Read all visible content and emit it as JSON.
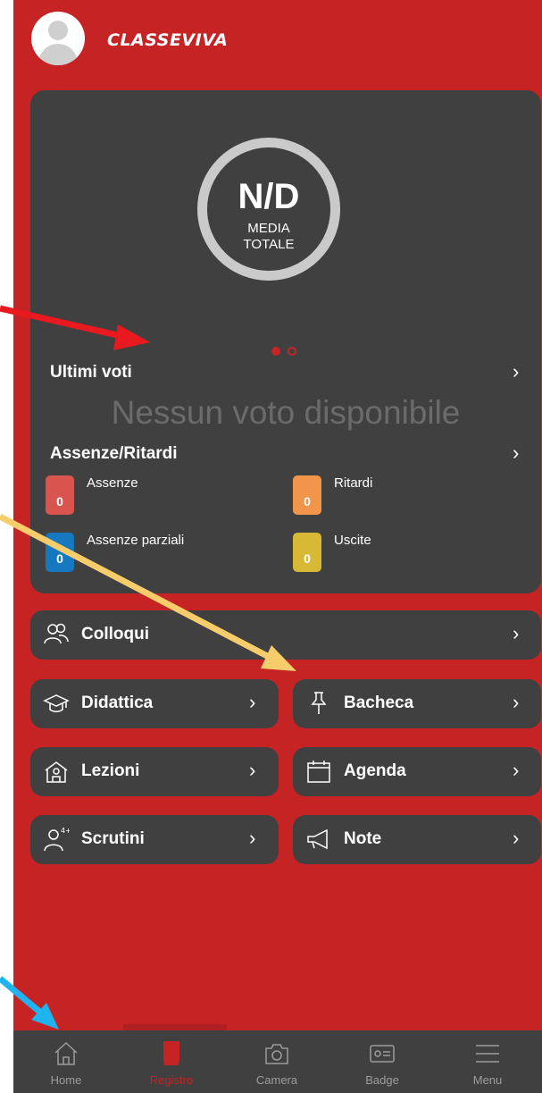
{
  "app": {
    "logo_text": "CLASSEVIVA"
  },
  "summary": {
    "average_value": "N/D",
    "average_label": "MEDIA TOTALE",
    "pager": {
      "pages": 2,
      "current": 1
    }
  },
  "grades": {
    "title": "Ultimi voti",
    "empty_message": "Nessun voto disponibile"
  },
  "attendance": {
    "title": "Assenze/Ritardi",
    "items": [
      {
        "label": "Assenze",
        "count": "0",
        "color": "#d9534f"
      },
      {
        "label": "Ritardi",
        "count": "0",
        "color": "#f0954a"
      },
      {
        "label": "Assenze parziali",
        "count": "0",
        "color": "#1679c0"
      },
      {
        "label": "Uscite",
        "count": "0",
        "color": "#d8b935"
      }
    ]
  },
  "menu": {
    "colloqui": "Colloqui",
    "didattica": "Didattica",
    "bacheca": "Bacheca",
    "lezioni": "Lezioni",
    "agenda": "Agenda",
    "scrutini": "Scrutini",
    "note": "Note"
  },
  "bottom_nav": {
    "items": [
      {
        "label": "Home",
        "icon": "home-icon"
      },
      {
        "label": "Registro",
        "icon": "book-icon",
        "active": true
      },
      {
        "label": "Camera",
        "icon": "camera-icon"
      },
      {
        "label": "Badge",
        "icon": "id-card-icon"
      },
      {
        "label": "Menu",
        "icon": "hamburger-icon"
      }
    ]
  },
  "colors": {
    "brand_red": "#c62325",
    "card_bg": "#404040",
    "annotation_red": "#e8191f",
    "annotation_yellow": "#f7cd6b",
    "annotation_blue": "#1fb4ef"
  }
}
